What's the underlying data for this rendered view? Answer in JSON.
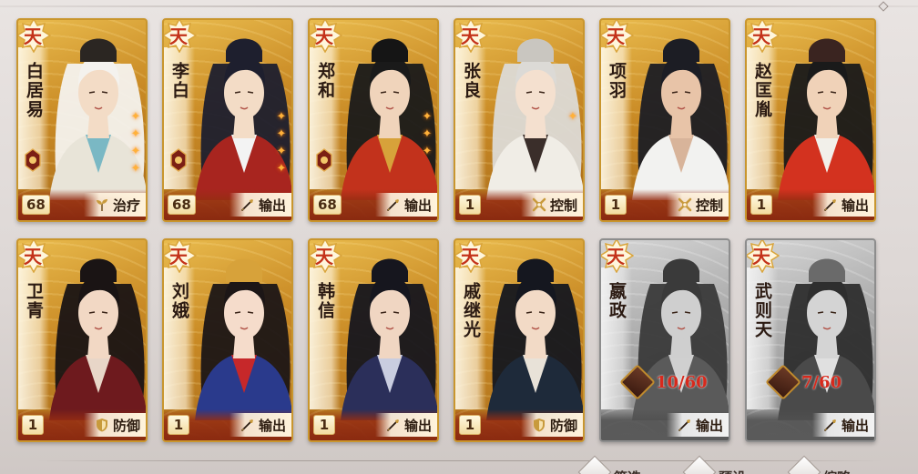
{
  "tier_label": "天",
  "roles": {
    "heal": "治疗",
    "dps": "输出",
    "control": "控制",
    "defense": "防御"
  },
  "heroes": [
    {
      "name": "白居易",
      "level": "68",
      "role": "治疗",
      "role_icon": "sprout-icon",
      "robe": "#e8e4d8",
      "accent": "#7ab8c4",
      "hair": "#f4f2ee",
      "skin": "#f3dcc6",
      "hat": "#2b2622",
      "gem": true,
      "stars": 4
    },
    {
      "name": "李白",
      "level": "68",
      "role": "输出",
      "role_icon": "brush-icon",
      "robe": "#a8251f",
      "accent": "#f3f3f3",
      "hair": "#1e1f2e",
      "skin": "#f3dcc6",
      "hat": "#1e1f2e",
      "gem": true,
      "stars": 4
    },
    {
      "name": "郑和",
      "level": "68",
      "role": "输出",
      "role_icon": "brush-icon",
      "robe": "#c2321c",
      "accent": "#d7a23a",
      "hair": "#1a1a1a",
      "skin": "#f0d4bb",
      "hat": "#151515",
      "gem": true,
      "stars": 3
    },
    {
      "name": "张良",
      "level": "1",
      "role": "控制",
      "role_icon": "cross-icon",
      "robe": "#f0ede6",
      "accent": "#3a2e2a",
      "hair": "#dcdad6",
      "skin": "#f4e0cf",
      "hat": "#c9c6c0",
      "gem": false,
      "stars": 1
    },
    {
      "name": "项羽",
      "level": "1",
      "role": "控制",
      "role_icon": "cross-icon",
      "robe": "#f2f2f0",
      "accent": "#d8b49a",
      "hair": "#1c1d24",
      "skin": "#e8c4a8",
      "hat": "#1c1d24",
      "gem": false,
      "stars": 0
    },
    {
      "name": "赵匡胤",
      "level": "1",
      "role": "输出",
      "role_icon": "brush-icon",
      "robe": "#d3321f",
      "accent": "#f2f0ea",
      "hair": "#1a1a1a",
      "skin": "#f0d2b8",
      "hat": "#3a2420",
      "gem": false,
      "stars": 0
    },
    {
      "name": "卫青",
      "level": "1",
      "role": "防御",
      "role_icon": "shield-icon",
      "robe": "#6e1a1e",
      "accent": "#e8d6c8",
      "hair": "#1a1414",
      "skin": "#f2d8c4",
      "hat": "#1a1414",
      "gem": false,
      "stars": 0
    },
    {
      "name": "刘娥",
      "level": "1",
      "role": "输出",
      "role_icon": "brush-icon",
      "robe": "#2a3a8c",
      "accent": "#c6282a",
      "hair": "#1c1616",
      "skin": "#f5dccb",
      "hat": "#d7a23a",
      "gem": false,
      "stars": 0
    },
    {
      "name": "韩信",
      "level": "1",
      "role": "输出",
      "role_icon": "brush-icon",
      "robe": "#2b2f5a",
      "accent": "#c9cde0",
      "hair": "#16161e",
      "skin": "#f0d6c2",
      "hat": "#16161e",
      "gem": false,
      "stars": 0
    },
    {
      "name": "戚继光",
      "level": "1",
      "role": "防御",
      "role_icon": "shield-icon",
      "robe": "#1e2a3a",
      "accent": "#e8e2d8",
      "hair": "#15171f",
      "skin": "#f2dac6",
      "hat": "#15171f",
      "gem": false,
      "stars": 0
    },
    {
      "name": "嬴政",
      "role": "输出",
      "role_icon": "brush-icon",
      "locked": true,
      "shards": "10/60",
      "robe": "#5a5a5a",
      "accent": "#d0d0d0",
      "hair": "#3a3a3a",
      "skin": "#cfcfcf",
      "hat": "#3a3a3a"
    },
    {
      "name": "武则天",
      "role": "输出",
      "role_icon": "brush-icon",
      "locked": true,
      "shards": "7/60",
      "robe": "#4a4a4a",
      "accent": "#e0e0e0",
      "hair": "#2e2e2e",
      "skin": "#d4d4d4",
      "hat": "#6a6a6a"
    }
  ],
  "bottom_buttons": [
    {
      "label": "筛选",
      "icon": "filter-icon"
    },
    {
      "label": "预设",
      "icon": "preset-icon"
    },
    {
      "label": "缩略",
      "icon": "collapse-icon"
    }
  ]
}
